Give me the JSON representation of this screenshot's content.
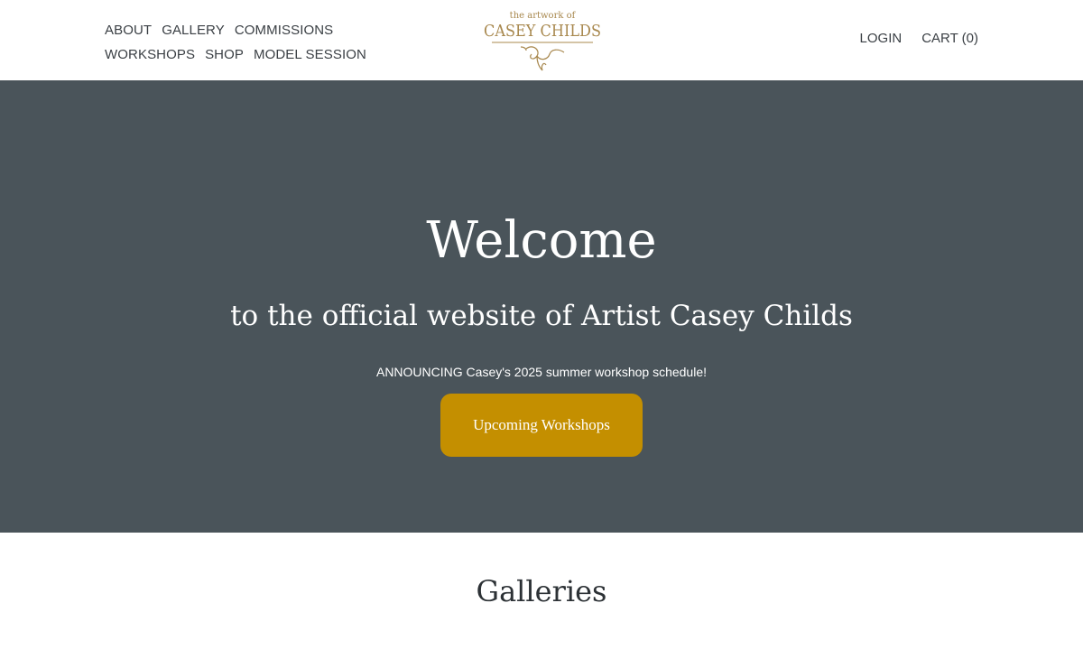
{
  "header": {
    "nav_row1": [
      "ABOUT",
      "GALLERY",
      "COMMISSIONS"
    ],
    "nav_row2": [
      "WORKSHOPS",
      "SHOP",
      "MODEL SESSION"
    ],
    "logo": {
      "line1": "the artwork of",
      "line2": "CASEY CHILDS",
      "color": "#a8884e"
    },
    "login_label": "LOGIN",
    "cart_label": "CART (0)"
  },
  "hero": {
    "title": "Welcome",
    "subtitle": "to the official website of Artist Casey Childs",
    "announcement": "ANNOUNCING Casey's 2025 summer workshop schedule!",
    "button_label": "Upcoming Workshops",
    "background": "#4a545a",
    "button_color": "#c48f00"
  },
  "galleries": {
    "title": "Galleries"
  }
}
